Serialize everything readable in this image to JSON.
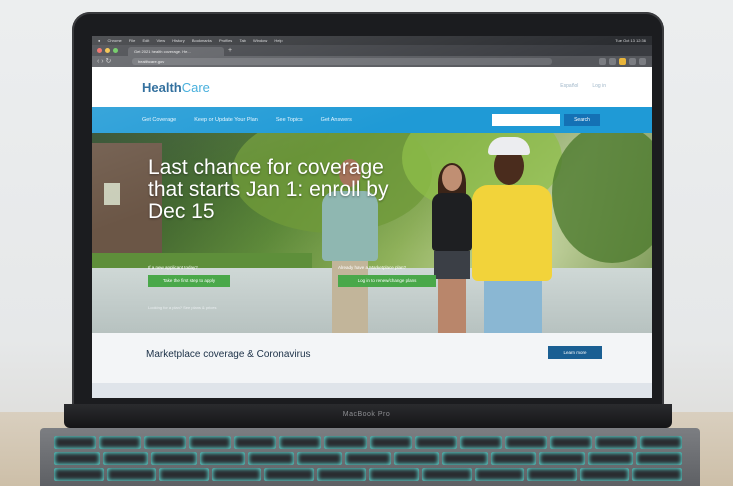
{
  "laptop": {
    "brand_label": "MacBook Pro"
  },
  "browser": {
    "menu_items": [
      "Chrome",
      "File",
      "Edit",
      "View",
      "History",
      "Bookmarks",
      "Profiles",
      "Tab",
      "Window",
      "Help"
    ],
    "status": "Tue Oct 13 12:36",
    "tab_title": "Get 2021 health coverage. He...",
    "url": "healthcare.gov"
  },
  "site": {
    "logo_main": "Health",
    "logo_accent": "Care",
    "header_links": [
      "Español",
      "Log in"
    ],
    "nav_items": [
      "Get Coverage",
      "Keep or Update Your Plan",
      "See Topics",
      "Get Answers"
    ],
    "search_button": "Search",
    "hero": {
      "title": "Last chance for coverage that starts Jan 1: enroll by Dec 15",
      "left_label": "If a new applicant today?",
      "left_button": "Take the first step to apply",
      "right_label": "Already have a Marketplace plan?",
      "right_button": "Log in to renew/change plans",
      "footnote": "Looking for a plan? See plans & prices"
    },
    "notice": {
      "text": "Marketplace coverage & Coronavirus",
      "button": "Learn more"
    }
  }
}
